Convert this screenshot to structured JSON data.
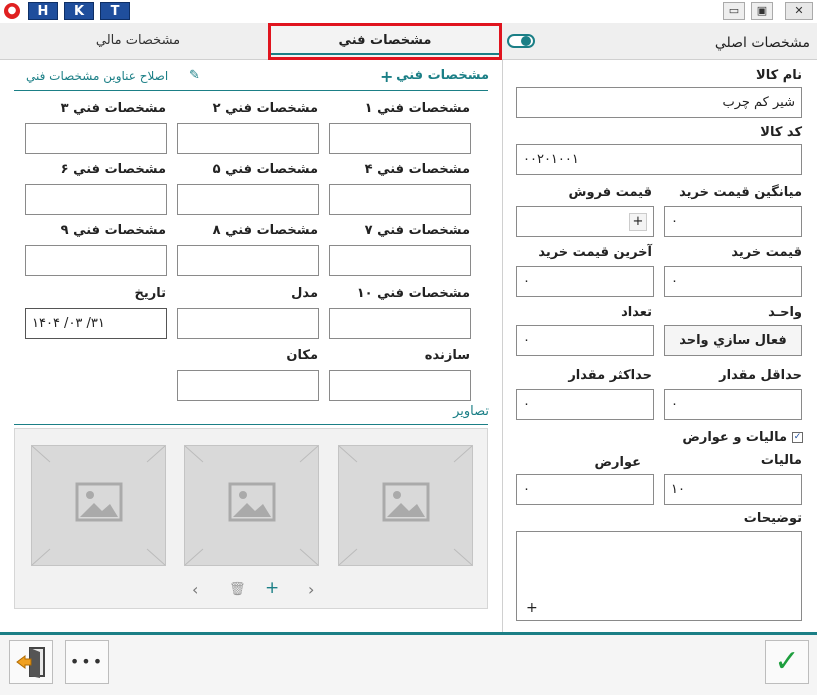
{
  "titlebar": {
    "app_icon": "tomato-icon",
    "hotkeys": [
      "H",
      "K",
      "T"
    ],
    "minimize": "▭",
    "maximize": "▣",
    "close": "✕"
  },
  "tabs": {
    "financial": "مشخصات مالي",
    "technical": "مشخصات فني",
    "main": "مشخصات اصلي"
  },
  "main": {
    "name_label": "نام كالا",
    "name_value": "شير کم چرب",
    "code_label": "کد کالا",
    "code_value": "۰۰۲۰۱۰۰۱",
    "avg_purchase_label": "ميانگين قيمت خريد",
    "avg_purchase_value": "۰",
    "sale_price_label": "قيمت فروش",
    "sale_plus": "+",
    "purchase_price_label": "قيمت خريد",
    "purchase_price_value": "۰",
    "last_purchase_label": "آخرين قيمت خريد",
    "last_purchase_value": "۰",
    "unit_label": "واحـد",
    "unit_button": "فعال سازي واحد",
    "count_label": "تعداد",
    "count_value": "۰",
    "min_label": "حداقل مقدار",
    "min_value": "۰",
    "max_label": "حداکثر مقدار",
    "max_value": "۰",
    "tax_checkbox_label": "ماليات و عوارض",
    "tax_checked": true,
    "tax_label": "ماليات",
    "tax_value": "۱۰",
    "duty_label": "عوارض",
    "duty_value": "۰",
    "desc_label": "توضيحات",
    "desc_plus": "+"
  },
  "technical": {
    "add_header": "مشخصات فني",
    "add_icon": "+",
    "edit_titles": "اصلاح عناوين مشخصات فني",
    "spec1": "مشخصات فني ۱",
    "spec2": "مشخصات فني ۲",
    "spec3": "مشخصات فني ۳",
    "spec4": "مشخصات فني ۴",
    "spec5": "مشخصات فني ۵",
    "spec6": "مشخصات فني ۶",
    "spec7": "مشخصات فني ۷",
    "spec8": "مشخصات فني ۸",
    "spec9": "مشخصات فني ۹",
    "spec10": "مشخصات فني ۱۰",
    "model_label": "مدل",
    "date_label": "تاريخ",
    "date_value": "۱۴۰۴   /۰۳  /۳۱",
    "maker_label": "سازنده",
    "location_label": "مکان",
    "images_header": "تصاوير",
    "nav_prev": "‹",
    "nav_delete": "🗑",
    "nav_add": "+",
    "nav_next": "›"
  },
  "footer": {
    "confirm": "✓",
    "more": "•••",
    "exit": "exit-icon"
  },
  "colors": {
    "accent": "#1b7f86",
    "highlight": "#e0141e",
    "hotkey": "#1f4e9c"
  }
}
